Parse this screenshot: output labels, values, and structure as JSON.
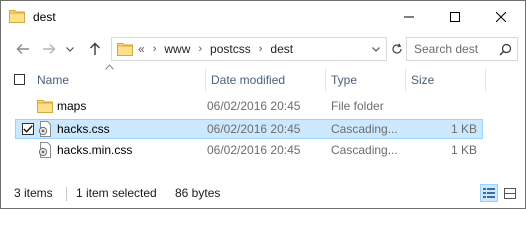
{
  "window": {
    "title": "dest",
    "minimize_glyph": "—",
    "maximize_glyph": "☐",
    "close_glyph": "✕"
  },
  "navigation": {
    "breadcrumb_overflow": "«",
    "breadcrumbs": [
      "www",
      "postcss",
      "dest"
    ],
    "search_placeholder": "Search dest"
  },
  "columns": {
    "name": "Name",
    "date_modified": "Date modified",
    "type": "Type",
    "size": "Size"
  },
  "files": [
    {
      "name": "maps",
      "date": "06/02/2016 20:45",
      "type": "File folder",
      "size": "",
      "icon": "folder-icon",
      "selected": false
    },
    {
      "name": "hacks.css",
      "date": "06/02/2016 20:45",
      "type": "Cascading...",
      "size": "1 KB",
      "icon": "css-file-icon",
      "selected": true
    },
    {
      "name": "hacks.min.css",
      "date": "06/02/2016 20:45",
      "type": "Cascading...",
      "size": "1 KB",
      "icon": "css-file-icon",
      "selected": false
    }
  ],
  "status": {
    "item_count": "3 items",
    "selection": "1 item selected",
    "selection_size": "86 bytes"
  },
  "colors": {
    "selection_bg": "#cce8ff",
    "selection_border": "#99d1ff",
    "header_text": "#4c607a",
    "folder": "#f8d775"
  }
}
